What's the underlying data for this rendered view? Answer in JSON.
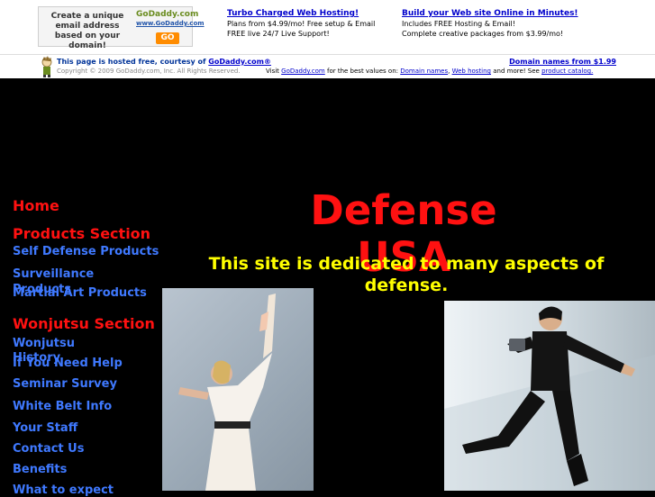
{
  "banner": {
    "ad_text": "Create a unique email address based on your domain!",
    "logo": "GoDaddy",
    "logo_suffix": ".com",
    "logo_site": "www.GoDaddy.com",
    "go_label": "GO",
    "promo1": {
      "title": "Turbo Charged Web Hosting!",
      "line1": "Plans from $4.99/mo! Free setup & Email",
      "line2": "FREE live 24/7 Live Support!"
    },
    "promo2": {
      "title": "Build your Web site Online in Minutes!",
      "line1": "Includes FREE Hosting & Email!",
      "line2": "Complete creative packages from $3.99/mo!"
    },
    "hosted_prefix": "This page is hosted free, courtesy of",
    "hosted_link": "GoDaddy.com®",
    "copyright": "Copyright © 2009 GoDaddy.com, Inc. All Rights Reserved.",
    "visit_prefix": "Visit",
    "visit_link": "GoDaddy.com",
    "visit_mid": "for the best values on:",
    "link_domains": "Domain names",
    "sep": ",",
    "link_hosting": "Web hosting",
    "visit_more": "and more! See",
    "link_catalog": "product catalog.",
    "domains_link": "Domain names from $1.99"
  },
  "nav": {
    "home": "Home",
    "products_section": "Products Section",
    "self_defense": "Self Defense Products",
    "surveillance": "Surveillance Products",
    "martial_art": "Martial Art Products",
    "wonjutsu_section": "Wonjutsu Section",
    "wonjutsu_history": "Wonjutsu History",
    "if_you_need_help": "If You Need Help",
    "seminar_survey": "Seminar Survey",
    "white_belt_info": "White Belt Info",
    "your_staff": "Your Staff",
    "contact_us": "Contact Us",
    "benefits": "Benefits",
    "what_to_expect": "What to expect"
  },
  "main": {
    "title": "Defense USA",
    "subtitle": "This site is dedicated to many aspects of defense."
  },
  "colors": {
    "background": "#000000",
    "nav_link": "#3f79ff",
    "heading_red": "#ff1111",
    "subtitle_yellow": "#ffff00",
    "link_blue": "#0000cc"
  }
}
